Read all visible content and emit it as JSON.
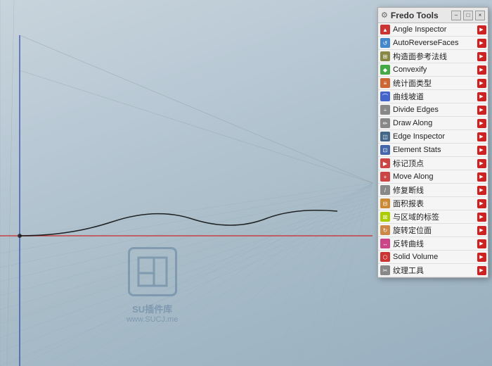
{
  "viewport": {
    "background_color": "#b8c8d4"
  },
  "watermark": {
    "text1": "SU插件库",
    "text2": "www.SUCJ.me"
  },
  "panel": {
    "title": "Fredo Tools",
    "minimize_label": "–",
    "maximize_label": "□",
    "close_label": "×",
    "tools": [
      {
        "id": "angle-inspector",
        "label": "Angle Inspector",
        "icon_type": "triangle-red",
        "has_arrow": true
      },
      {
        "id": "auto-reverse-faces",
        "label": "AutoReverseFaces",
        "icon_type": "reverse",
        "has_arrow": true
      },
      {
        "id": "construct-reference",
        "label": "构造面参考法线",
        "icon_type": "construct",
        "has_arrow": true
      },
      {
        "id": "convexify",
        "label": "Convexify",
        "icon_type": "convex",
        "has_arrow": true
      },
      {
        "id": "count-face-types",
        "label": "统计面类型",
        "icon_type": "stats",
        "has_arrow": true
      },
      {
        "id": "curve-roads",
        "label": "曲线坡道",
        "icon_type": "curve",
        "has_arrow": true
      },
      {
        "id": "divide-edges",
        "label": "Divide Edges",
        "icon_type": "divide",
        "has_arrow": true
      },
      {
        "id": "draw-along",
        "label": "Draw Along",
        "icon_type": "draw",
        "has_arrow": true
      },
      {
        "id": "edge-inspector",
        "label": "Edge Inspector",
        "icon_type": "edge",
        "has_arrow": true
      },
      {
        "id": "element-stats",
        "label": "Element Stats",
        "icon_type": "element",
        "has_arrow": true
      },
      {
        "id": "mark-vertices",
        "label": "标记顶点",
        "icon_type": "vertex",
        "has_arrow": true
      },
      {
        "id": "move-along",
        "label": "Move Along",
        "icon_type": "move",
        "has_arrow": true
      },
      {
        "id": "repair-lines",
        "label": "修复断线",
        "icon_type": "repair",
        "has_arrow": true
      },
      {
        "id": "area-report",
        "label": "面积报表",
        "icon_type": "area",
        "has_arrow": true
      },
      {
        "id": "area-label",
        "label": "与区域的标签",
        "icon_type": "label",
        "has_arrow": true
      },
      {
        "id": "rotate-face",
        "label": "旋转定位面",
        "icon_type": "rotate-face",
        "has_arrow": true
      },
      {
        "id": "reverse-curve",
        "label": "反转曲线",
        "icon_type": "reverse-curve",
        "has_arrow": true
      },
      {
        "id": "solid-volume",
        "label": "Solid Volume",
        "icon_type": "solid",
        "has_arrow": true
      },
      {
        "id": "texture-tool",
        "label": "纹理工具",
        "icon_type": "texture",
        "has_arrow": true
      }
    ]
  }
}
